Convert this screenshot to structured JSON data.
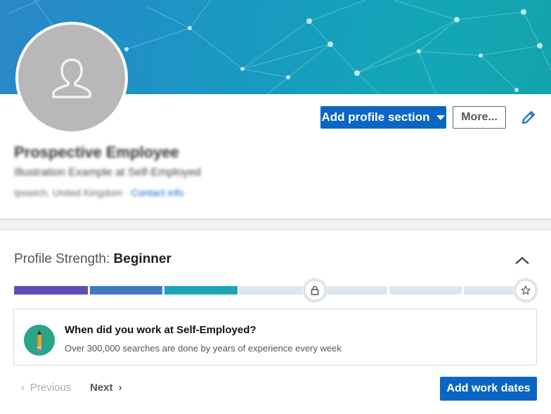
{
  "profile": {
    "name": "Prospective Employee",
    "headline": "Illustration Example at Self-Employed",
    "location": "Ipswich, United Kingdom",
    "separator": "·",
    "contact_info": "Contact info",
    "add_section_label": "Add profile section",
    "more_label": "More...",
    "icons": {
      "avatar": "person-icon",
      "add_section": "caret-down-icon",
      "edit": "pencil-icon"
    }
  },
  "strength": {
    "label": "Profile Strength:",
    "level": "Beginner",
    "filled_fraction": 0.43,
    "segments_total": 7,
    "segments_filled": 3,
    "colors": {
      "seg1": "#5b4fb5",
      "seg2": "#3f79c0",
      "seg3": "#1aa5b8",
      "empty": "#dfe6eb"
    },
    "icons": {
      "collapse": "chevron-up-icon",
      "milestone1": "lock-icon",
      "milestone2": "star-icon"
    }
  },
  "suggestion": {
    "title": "When did you work at Self-Employed?",
    "subtitle": "Over 300,000 searches are done by years of experience every week",
    "icon": "pencil-badge-icon"
  },
  "nav": {
    "previous": "Previous",
    "next": "Next",
    "primary_action": "Add work dates"
  },
  "colors": {
    "brand": "#0a66c2"
  }
}
